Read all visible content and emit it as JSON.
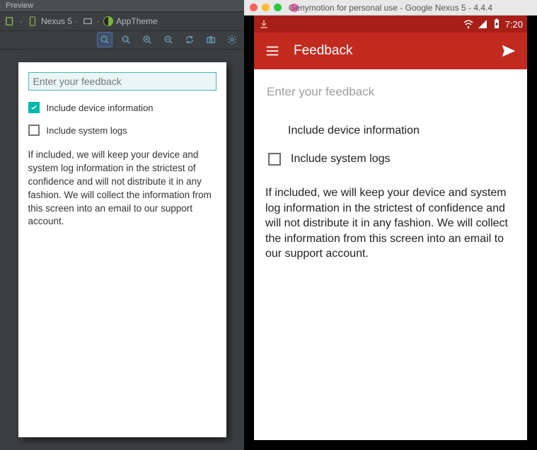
{
  "left": {
    "tab_label": "Preview",
    "device_selector": "Nexus 5",
    "theme_label": "AppTheme",
    "preview": {
      "feedback_placeholder": "Enter your feedback",
      "check_device_label": "Include device information",
      "check_device_checked": true,
      "check_logs_label": "Include system logs",
      "check_logs_checked": false,
      "body_text": "If included, we will keep your device and system log information in the strictest of confidence and will not distribute it in any fashion. We will collect the information from this screen into an email to our support account."
    }
  },
  "right": {
    "window_title": "Genymotion for personal use - Google Nexus 5 - 4.4.4",
    "status": {
      "time": "7:20"
    },
    "actionbar": {
      "title": "Feedback"
    },
    "content": {
      "feedback_placeholder": "Enter your feedback",
      "device_info_label": "Include device information",
      "check_logs_label": "Include system logs",
      "check_logs_checked": false,
      "body_text": "If included, we will keep your device and system log information in the strictest of confidence and will not distribute it in any fashion. We will collect the information from this screen into an email to our support account."
    }
  }
}
